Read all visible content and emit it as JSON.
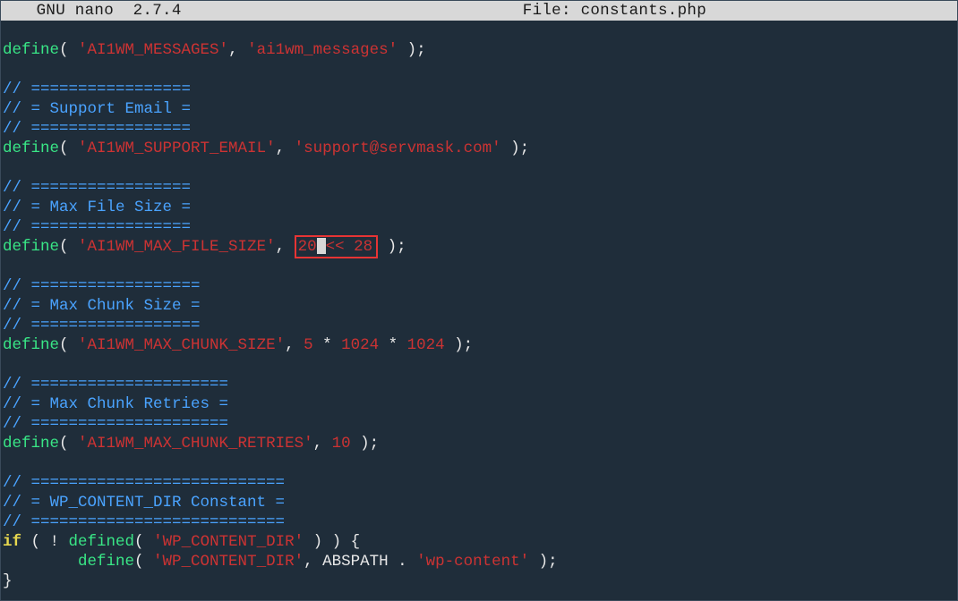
{
  "titlebar": {
    "app": "  GNU nano  2.7.4",
    "file_label": "File: constants.php"
  },
  "line1": {
    "func": "define",
    "open": "( ",
    "str1": "'AI1WM_MESSAGES'",
    "sep": ", ",
    "str2": "'ai1wm_messages'",
    "close": " );"
  },
  "sec_support": {
    "bar": "// =================",
    "head": "// = Support Email ="
  },
  "line_support": {
    "func": "define",
    "open": "( ",
    "str1": "'AI1WM_SUPPORT_EMAIL'",
    "sep": ", ",
    "str2": "'support@servmask.com'",
    "close": " );"
  },
  "sec_filesize": {
    "bar": "// =================",
    "head": "// = Max File Size ="
  },
  "line_filesize": {
    "func": "define",
    "open": "( ",
    "str1": "'AI1WM_MAX_FILE_SIZE'",
    "sep": ", ",
    "val_before": "20",
    "val_after": "<< 28",
    "close": " );"
  },
  "sec_chunksize": {
    "bar": "// ==================",
    "head": "// = Max Chunk Size ="
  },
  "line_chunksize": {
    "func": "define",
    "open": "( ",
    "str1": "'AI1WM_MAX_CHUNK_SIZE'",
    "sep": ", ",
    "n1": "5",
    "op1": " * ",
    "n2": "1024",
    "op2": " * ",
    "n3": "1024",
    "close": " );"
  },
  "sec_retries": {
    "bar": "// =====================",
    "head": "// = Max Chunk Retries ="
  },
  "line_retries": {
    "func": "define",
    "open": "( ",
    "str1": "'AI1WM_MAX_CHUNK_RETRIES'",
    "sep": ", ",
    "n1": "10",
    "close": " );"
  },
  "sec_wpcontent": {
    "bar": "// ===========================",
    "head": "// = WP_CONTENT_DIR Constant ="
  },
  "line_if": {
    "kw": "if",
    "open": " ( ! ",
    "func": "defined",
    "fopen": "( ",
    "str": "'WP_CONTENT_DIR'",
    "fclose": " ) ) {",
    "indent": "        ",
    "func2": "define",
    "f2open": "( ",
    "str2": "'WP_CONTENT_DIR'",
    "sep": ", ABSPATH . ",
    "str3": "'wp-content'",
    "f2close": " );",
    "closebrace": "}"
  }
}
